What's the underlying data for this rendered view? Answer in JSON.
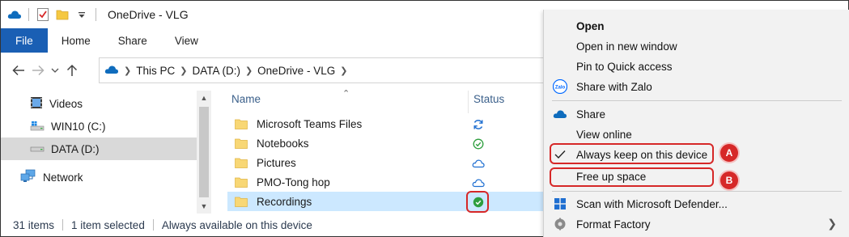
{
  "titlebar": {
    "title": "OneDrive - VLG",
    "icons": [
      "onedrive-cloud-icon",
      "properties-checklist-icon",
      "new-folder-icon",
      "customize-quick-access-icon"
    ]
  },
  "ribbon": {
    "tabs": [
      "File",
      "Home",
      "Share",
      "View"
    ]
  },
  "address": {
    "breadcrumbs": [
      "This PC",
      "DATA (D:)",
      "OneDrive - VLG"
    ]
  },
  "nav_pane": {
    "items": [
      {
        "label": "Videos",
        "icon": "videos-icon"
      },
      {
        "label": "WIN10 (C:)",
        "icon": "windows-drive-icon"
      },
      {
        "label": "DATA (D:)",
        "icon": "drive-icon",
        "selected": true
      },
      {
        "label": "Network",
        "icon": "network-icon"
      }
    ]
  },
  "file_list": {
    "columns": {
      "name": "Name",
      "status": "Status"
    },
    "rows": [
      {
        "name": "Microsoft Teams Files",
        "status": "sync-pending-icon"
      },
      {
        "name": "Notebooks",
        "status": "available-locally-icon"
      },
      {
        "name": "Pictures",
        "status": "online-only-icon"
      },
      {
        "name": "PMO-Tong hop",
        "status": "online-only-icon"
      },
      {
        "name": "Recordings",
        "status": "always-available-icon",
        "selected": true
      }
    ]
  },
  "statusbar": {
    "items_count": "31 items",
    "selection": "1 item selected",
    "availability": "Always available on this device"
  },
  "context_menu": {
    "items": [
      {
        "label": "Open",
        "bold": true
      },
      {
        "label": "Open in new window"
      },
      {
        "label": "Pin to Quick access"
      },
      {
        "label": "Share with Zalo",
        "icon": "zalo-icon",
        "icon_text": "Zalo"
      },
      {
        "label": "Share",
        "icon": "onedrive-cloud-icon"
      },
      {
        "label": "View online"
      },
      {
        "label": "Always keep on this device",
        "checked": true
      },
      {
        "label": "Free up space"
      },
      {
        "label": "Scan with Microsoft Defender...",
        "icon": "defender-shield-icon"
      },
      {
        "label": "Format Factory",
        "icon": "format-factory-icon",
        "submenu": true
      }
    ]
  },
  "annotations": {
    "badge_a": "A",
    "badge_b": "B",
    "highlight_color": "#d62828"
  },
  "colors": {
    "accent": "#1a5fb4",
    "selection": "#cce8ff",
    "onedrive": "#0f6cbd",
    "synced_green": "#2e9e3e"
  }
}
